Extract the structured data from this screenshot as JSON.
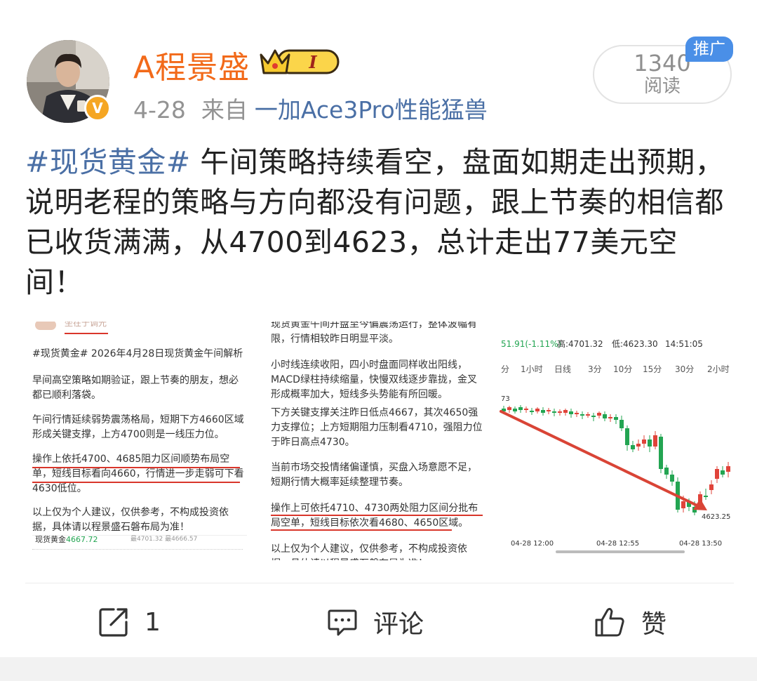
{
  "author": {
    "name": "A程景盛",
    "verified_badge": "V",
    "level_badge": "I",
    "avatar": "avatar-photo"
  },
  "meta": {
    "date": "4-28",
    "from_label": "来自",
    "source": "一加Ace3Pro性能猛兽"
  },
  "views": {
    "count": "1340",
    "label": "阅读",
    "promo_tag": "推广"
  },
  "post": {
    "hashtag": "#现货黄金#",
    "text": " 午间策略持续看空，盘面如期走出预期，说明老程的策略与方向都没有问题，跟上节奏的相信都已收货满满，从4700到4623，总计走出77美元空间！"
  },
  "images": {
    "img1": {
      "top_clip": "坐在于调光",
      "hashtag_title": "#现货黄金# 2026年4月28日现货黄金午间解析",
      "p1": "早间高空策略如期验证，跟上节奏的朋友，想必都已顺利落袋。",
      "p2": "午间行情延续弱势震荡格局，短期下方4660区域形成关键支撑，上方4700则是一线压力位。",
      "p3": "操作上依托4700、4685阻力区间顺势布局空单，短线目标看向4660，行情进一步走弱可下看4630低位。",
      "p4": "以上仅为个人建议，仅供参考，不构成投资依据，具体请以程景盛石磐布局为准！",
      "footer_name": "现货黄金",
      "footer_price": "4667.72",
      "footer_extra": "最4701.32  最4666.57"
    },
    "img2": {
      "top_clip": "现货黄金午间开盘至今偏震荡运行，整体波幅有限，行情相较昨日明显平淡。",
      "p1": "小时线连续收阳，四小时盘面同样收出阳线，MACD绿柱持续缩量，快慢双线逐步靠拢，金叉形成概率加大，短线多头势能有所回暖。",
      "p2": "下方关键支撑关注昨日低点4667，其次4650强力支撑位；上方短期阻力压制看4710，强阻力位于昨日高点4730。",
      "p3": "当前市场交投情绪偏谨慎，买盘入场意愿不足，短期行情大概率延续整理节奏。",
      "p4": "操作上可依托4710、4730两处阻力区间分批布局空单，短线目标依次看4680、4650区域。",
      "p5": "以上仅为个人建议，仅供参考，不构成投资依据，具体请以程景盛石磐布局为准！"
    },
    "img3": {
      "change": "51.91(-1.11%)",
      "high": "高:4701.32",
      "low": "低:4623.30",
      "time": "14:51:05",
      "tabs": [
        "分",
        "1小时",
        "日线",
        "3分",
        "10分",
        "15分",
        "30分",
        "2小时"
      ],
      "left_price": "73",
      "end_price": "4623.25",
      "x_labels": [
        "04-28 12:00",
        "04-28 12:55",
        "04-28 13:50"
      ],
      "up_color": "#e0433a",
      "down_color": "#23a552",
      "arrow_color": "#d94436"
    }
  },
  "actions": {
    "repost_count": "1",
    "comment_label": "评论",
    "like_label": "赞"
  }
}
